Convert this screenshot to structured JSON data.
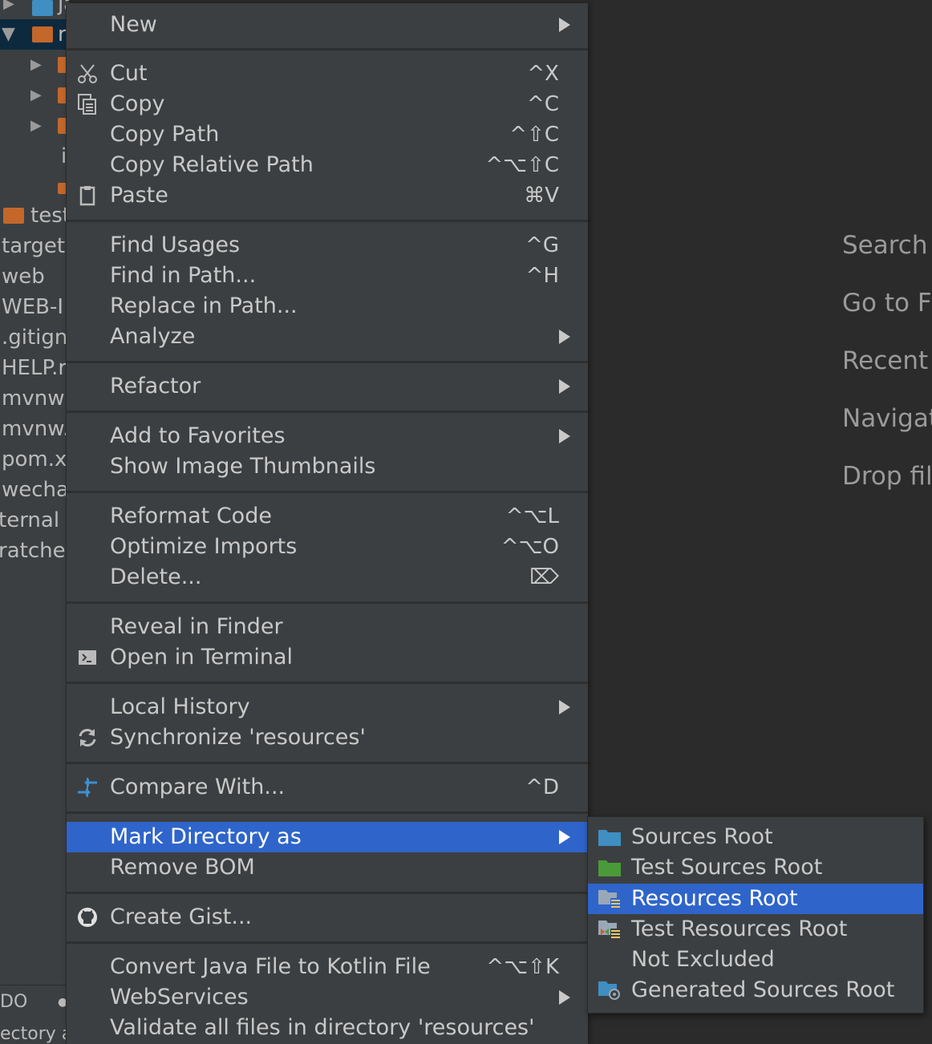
{
  "project_tree": {
    "rows": [
      "java",
      "r",
      "",
      "",
      "",
      "i",
      "",
      "test",
      "target",
      "web",
      "WEB-I",
      ".gitign",
      "HELP.r",
      "mvnw",
      "mvnw.",
      "pom.xı",
      "wecha",
      "ternal L",
      "ratches"
    ],
    "bottom_rows": [
      "DO",
      "ectory as"
    ]
  },
  "editor_hints": [
    "Search",
    "Go to F",
    "Recent",
    "Navigat",
    "Drop fil"
  ],
  "context_menu": {
    "items": [
      {
        "label": "New",
        "shortcut": ""
      },
      {
        "label": "Cut",
        "shortcut": "^X"
      },
      {
        "label": "Copy",
        "shortcut": "^C"
      },
      {
        "label": "Copy Path",
        "shortcut": "^⇧C"
      },
      {
        "label": "Copy Relative Path",
        "shortcut": "^⌥⇧C"
      },
      {
        "label": "Paste",
        "shortcut": "⌘V"
      },
      {
        "label": "Find Usages",
        "shortcut": "^G"
      },
      {
        "label": "Find in Path...",
        "shortcut": "^H"
      },
      {
        "label": "Replace in Path...",
        "shortcut": ""
      },
      {
        "label": "Analyze",
        "shortcut": ""
      },
      {
        "label": "Refactor",
        "shortcut": ""
      },
      {
        "label": "Add to Favorites",
        "shortcut": ""
      },
      {
        "label": "Show Image Thumbnails",
        "shortcut": ""
      },
      {
        "label": "Reformat Code",
        "shortcut": "^⌥L"
      },
      {
        "label": "Optimize Imports",
        "shortcut": "^⌥O"
      },
      {
        "label": "Delete...",
        "shortcut": "⌦"
      },
      {
        "label": "Reveal in Finder",
        "shortcut": ""
      },
      {
        "label": "Open in Terminal",
        "shortcut": ""
      },
      {
        "label": "Local History",
        "shortcut": ""
      },
      {
        "label": "Synchronize 'resources'",
        "shortcut": ""
      },
      {
        "label": "Compare With...",
        "shortcut": "^D"
      },
      {
        "label": "Mark Directory as",
        "shortcut": ""
      },
      {
        "label": "Remove BOM",
        "shortcut": ""
      },
      {
        "label": "Create Gist...",
        "shortcut": ""
      },
      {
        "label": "Convert Java File to Kotlin File",
        "shortcut": "^⌥⇧K"
      },
      {
        "label": "WebServices",
        "shortcut": ""
      },
      {
        "label": "Validate all files in directory 'resources'",
        "shortcut": ""
      }
    ]
  },
  "submenu": {
    "items": [
      {
        "label": "Sources Root"
      },
      {
        "label": "Test Sources Root"
      },
      {
        "label": "Resources Root"
      },
      {
        "label": "Test Resources Root"
      },
      {
        "label": "Not Excluded"
      },
      {
        "label": "Generated Sources Root"
      }
    ]
  },
  "colors": {
    "highlight": "#2f65ca",
    "menu_bg": "#3c3f41",
    "folder_orange": "#c3672b",
    "folder_blue": "#3f8fc2",
    "folder_green": "#4a9a3a"
  }
}
